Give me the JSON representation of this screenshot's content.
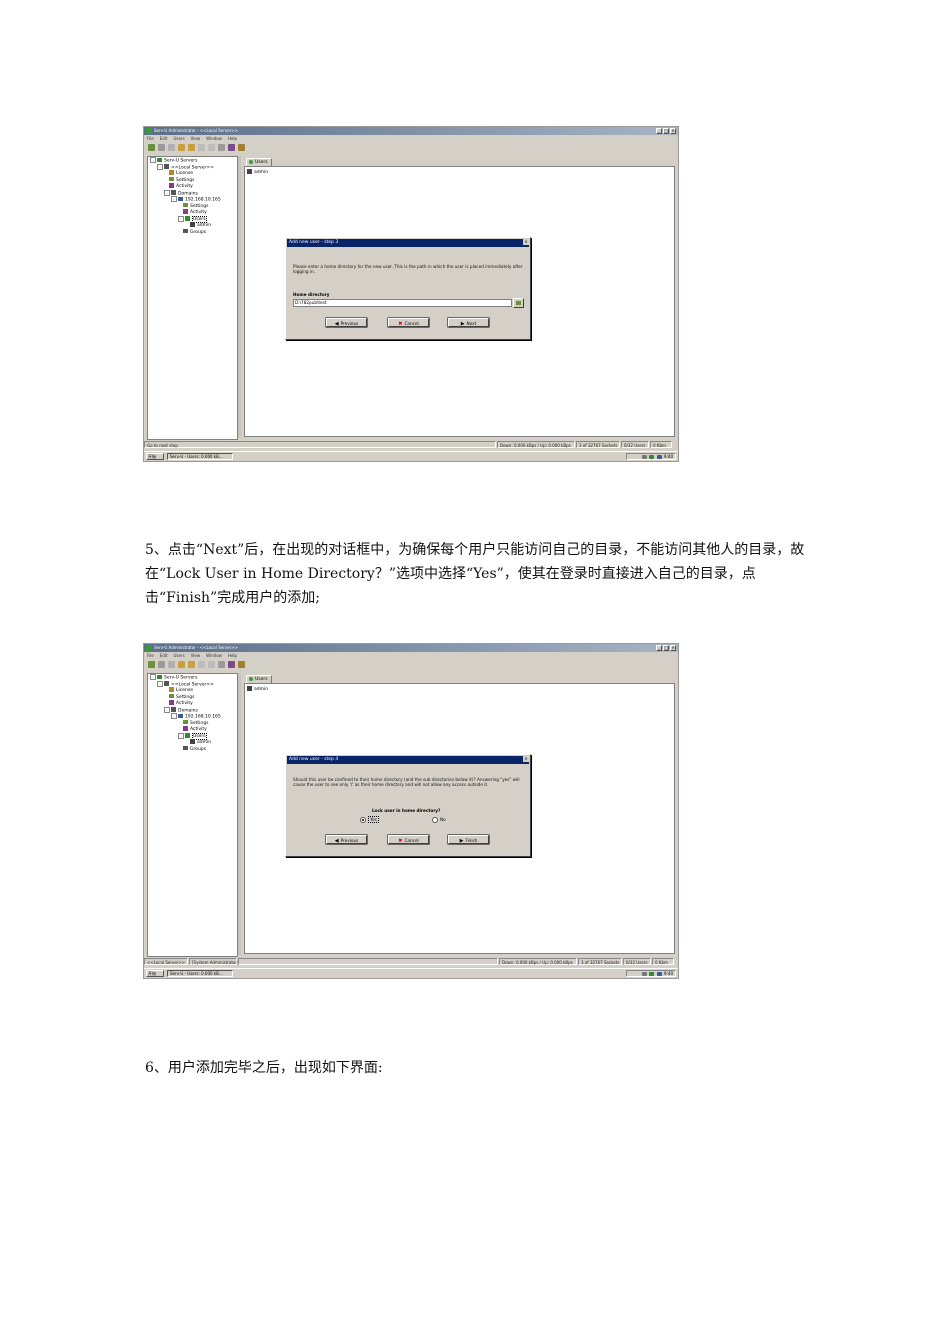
{
  "screenshot1": {
    "window_title": "Serv-U Administrator - <<Local Server>>",
    "menu": [
      "File",
      "Edit",
      "Users",
      "View",
      "Window",
      "Help"
    ],
    "tree": [
      {
        "label": "Serv-U Servers",
        "indent": 0,
        "exp": "-",
        "color": "#2e8b2e"
      },
      {
        "label": "<<Local Server>>",
        "indent": 1,
        "exp": "-",
        "color": "#555555"
      },
      {
        "label": "License",
        "indent": 2,
        "exp": "",
        "color": "#b08a2a"
      },
      {
        "label": "Settings",
        "indent": 2,
        "exp": "",
        "color": "#6b8f3a"
      },
      {
        "label": "Activity",
        "indent": 2,
        "exp": "",
        "color": "#8a3a8a"
      },
      {
        "label": "Domains",
        "indent": 2,
        "exp": "-",
        "color": "#555555"
      },
      {
        "label": "192.168.10.165",
        "indent": 3,
        "exp": "-",
        "color": "#3a5a9a"
      },
      {
        "label": "Settings",
        "indent": 4,
        "exp": "",
        "color": "#6b8f3a"
      },
      {
        "label": "Activity",
        "indent": 4,
        "exp": "",
        "color": "#8a3a8a"
      },
      {
        "label": "Users",
        "indent": 4,
        "exp": "-",
        "color": "#2e8b2e"
      },
      {
        "label": "admin",
        "indent": 5,
        "exp": "",
        "color": "#444444"
      },
      {
        "label": "Groups",
        "indent": 4,
        "exp": "",
        "color": "#555555"
      }
    ],
    "tab_label": "Users",
    "list_item": "admin",
    "status": [
      "Go to next step",
      "Down: 0.000 kBps / Up: 0.000 kBps",
      "3 of 32767 Sockets",
      "0/32 Users",
      "0 Kbm"
    ],
    "taskbar": {
      "start": "开始",
      "task": "Serv-U - Users: 0.000 kB...",
      "clock": "9:40"
    },
    "dialog": {
      "title": "Add new user - step 3",
      "text": "Please enter a home directory for the new user. This is the path in which the user is placed immediately after logging in.",
      "label": "Home directory",
      "value": "D:\\782pub\\test",
      "buttons": {
        "previous": "Previous",
        "cancel": "Cancel",
        "next": "Next"
      }
    }
  },
  "paragraph1": "5、点击“Next”后，在出现的对话框中，为确保每个用户只能访问自己的目录，不能访问其他人的目录，故在“Lock User in Home Directory？”选项中选择“Yes”，使其在登录时直接进入自己的目录，点击“Finish”完成用户的添加;",
  "screenshot2": {
    "window_title": "Serv-U Administrator - <<Local Server>>",
    "status": [
      "<<Local Server>>",
      "[System Administrator]",
      "Down: 0.000 kBps / Up: 0.000 kBps",
      "3 of 32767 Sockets",
      "0/32 Users",
      "0 Kbm"
    ],
    "dialog": {
      "title": "Add new user - step 4",
      "text": "Should this user be confined to their home directory (and the sub directories below it)? Answering \"yes\" will cause the user to see only '/' as their home directory and will not allow any access outside it.",
      "label": "Lock user in home directory?",
      "options": [
        "Yes",
        "No"
      ],
      "selected": "Yes",
      "buttons": {
        "previous": "Previous",
        "cancel": "Cancel",
        "finish": "Finish"
      }
    }
  },
  "paragraph2": "6、用户添加完毕之后，出现如下界面:",
  "colors": {
    "dialog_title": "#0a246a",
    "window_face": "#d4d0c8",
    "window_title": "#5a6e8a"
  }
}
